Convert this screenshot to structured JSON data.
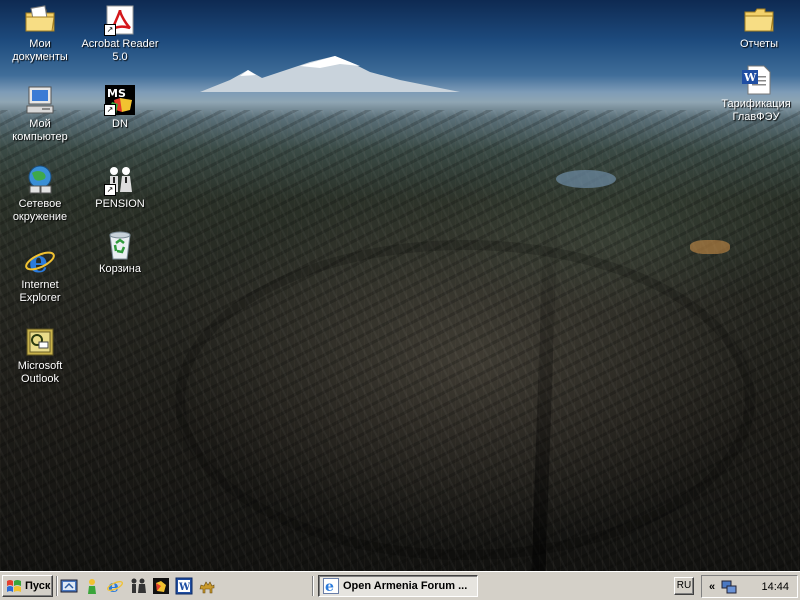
{
  "desktop": {
    "icons": [
      {
        "id": "my-documents",
        "label": "Мои документы",
        "icon": "folder-documents-icon"
      },
      {
        "id": "my-computer",
        "label": "Мой компьютер",
        "icon": "computer-icon"
      },
      {
        "id": "network",
        "label": "Сетевое окружение",
        "icon": "network-places-icon"
      },
      {
        "id": "ie",
        "label": "Internet Explorer",
        "icon": "internet-explorer-icon"
      },
      {
        "id": "outlook",
        "label": "Microsoft Outlook",
        "icon": "outlook-icon"
      },
      {
        "id": "acrobat",
        "label": "Acrobat Reader 5.0",
        "icon": "acrobat-reader-icon"
      },
      {
        "id": "dn",
        "label": "DN",
        "icon": "ms-dos-app-icon"
      },
      {
        "id": "pension",
        "label": "PENSION",
        "icon": "people-app-icon"
      },
      {
        "id": "recycle",
        "label": "Корзина",
        "icon": "recycle-bin-icon"
      },
      {
        "id": "reports",
        "label": "Отчеты",
        "icon": "folder-icon"
      },
      {
        "id": "tarif",
        "label": "Тарификация ГлавФЭУ",
        "icon": "word-document-icon"
      }
    ],
    "dos_icon_text": "MS"
  },
  "taskbar": {
    "start_label": "Пуск",
    "quick_launch": [
      "desktop-show-icon",
      "messenger-icon",
      "internet-explorer-icon",
      "users-icon",
      "puzzle-app-icon",
      "word-icon",
      "camel-icon"
    ],
    "window_button": "Open Armenia Forum ...",
    "language": "RU",
    "tray_chevron": "«",
    "clock": "14:44"
  },
  "colors": {
    "taskbar_bg": "#d4d0c8",
    "icon_label": "#ffffff"
  }
}
